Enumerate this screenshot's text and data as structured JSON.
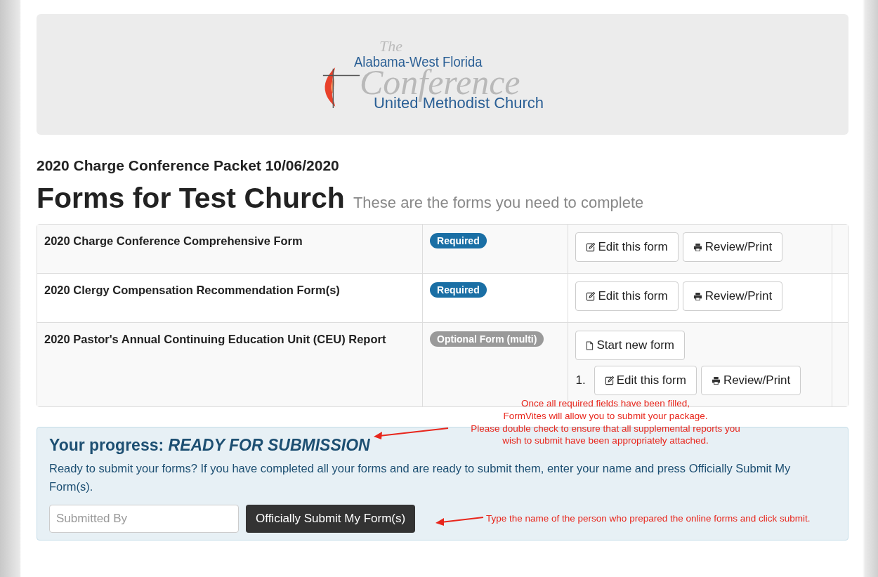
{
  "logo": {
    "the": "The",
    "line1": "Alabama-West Florida",
    "line2": "Conference",
    "line3": "United Methodist Church"
  },
  "packet_title": "2020 Charge Conference Packet 10/06/2020",
  "heading": "Forms for Test Church",
  "subheading": "These are the forms you need to complete",
  "forms": [
    {
      "name": "2020 Charge Conference Comprehensive Form",
      "badge": {
        "kind": "required",
        "label": "Required"
      },
      "entries": [
        {
          "buttons": [
            {
              "kind": "edit",
              "label": "Edit this form"
            },
            {
              "kind": "print",
              "label": "Review/Print"
            }
          ]
        }
      ]
    },
    {
      "name": "2020 Clergy Compensation Recommendation Form(s)",
      "badge": {
        "kind": "required",
        "label": "Required"
      },
      "entries": [
        {
          "buttons": [
            {
              "kind": "edit",
              "label": "Edit this form"
            },
            {
              "kind": "print",
              "label": "Review/Print"
            }
          ]
        }
      ]
    },
    {
      "name": "2020 Pastor's Annual Continuing Education Unit (CEU) Report",
      "badge": {
        "kind": "optional",
        "label": "Optional Form (multi)"
      },
      "start": {
        "kind": "new",
        "label": "Start new form"
      },
      "entries": [
        {
          "number": "1.",
          "buttons": [
            {
              "kind": "edit",
              "label": "Edit this form"
            },
            {
              "kind": "print",
              "label": "Review/Print"
            }
          ]
        }
      ]
    }
  ],
  "progress": {
    "label": "Your progress:",
    "status": "READY FOR SUBMISSION",
    "text": "Ready to submit your forms? If you have completed all your forms and are ready to submit them, enter your name and press Officially Submit My Form(s).",
    "placeholder": "Submitted By",
    "submit": "Officially Submit My Form(s)"
  },
  "annotations": [
    {
      "lines": [
        "Once all required fields have been filled,",
        "FormVites will allow you to submit your package.",
        "Please double check to ensure that all supplemental reports you",
        "wish to submit have been appropriately attached."
      ]
    },
    {
      "lines": [
        "Type the name of the person who prepared the online forms and click submit."
      ]
    }
  ]
}
